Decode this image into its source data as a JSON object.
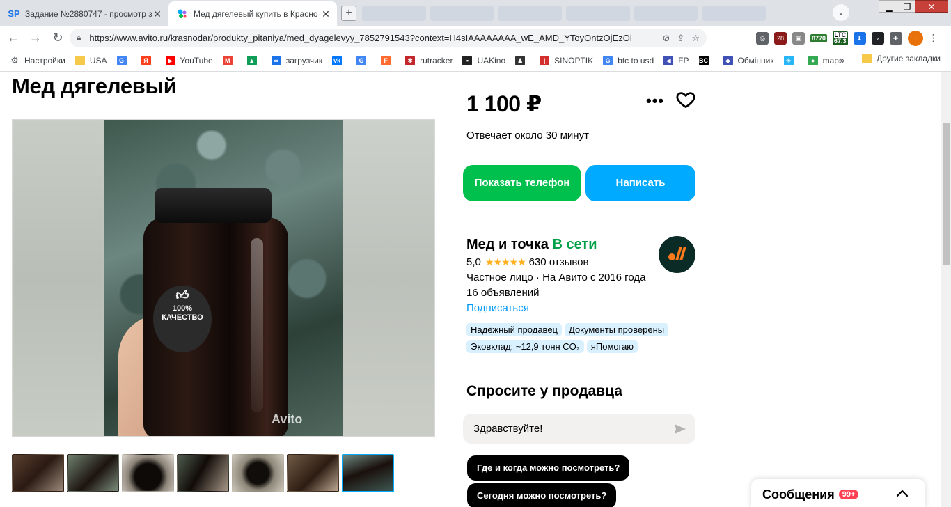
{
  "browser": {
    "tabs": [
      {
        "favicon": "SP",
        "title": "Задание №2880747 - просмотр з"
      },
      {
        "favicon": "avito-icon",
        "title": "Мед дягелевый купить в Красно"
      }
    ],
    "url": "https://www.avito.ru/krasnodar/produkty_pitaniya/med_dyagelevyy_7852791543?context=H4sIAAAAAAAA_wE_AMD_YToyOntzOjEzOi",
    "ext_counter_1": "28",
    "ext_counter_2": "8770",
    "ext_ltc_label": "LTC",
    "ext_ltc_value": "67.3",
    "profile_letter": "I"
  },
  "bookmarks": {
    "items": [
      {
        "label": "Настройки",
        "icon": "gear-icon",
        "color": "#5f6368"
      },
      {
        "label": "USA",
        "icon": "folder-icon",
        "color": "#f6c94a"
      },
      {
        "label": "",
        "icon": "google-icon",
        "color": "#4285f4"
      },
      {
        "label": "",
        "icon": "yandex-icon",
        "color": "#fc3f1d"
      },
      {
        "label": "YouTube",
        "icon": "youtube-icon",
        "color": "#ff0000"
      },
      {
        "label": "",
        "icon": "gmail-icon",
        "color": "#ea4335"
      },
      {
        "label": "",
        "icon": "drive-icon",
        "color": "#0f9d58"
      },
      {
        "label": "загрузчик",
        "icon": "loader-icon",
        "color": "#1a73e8"
      },
      {
        "label": "",
        "icon": "vk-icon",
        "color": "#0077ff"
      },
      {
        "label": "",
        "icon": "translate-icon",
        "color": "#4285f4"
      },
      {
        "label": "",
        "icon": "f-icon",
        "color": "#ff6a2f"
      },
      {
        "label": "rutracker",
        "icon": "rutracker-icon",
        "color": "#c3272b"
      },
      {
        "label": "UAKino",
        "icon": "uakino-icon",
        "color": "#222222"
      },
      {
        "label": "",
        "icon": "bookmark-icon",
        "color": "#333333"
      },
      {
        "label": "SINOPTIK",
        "icon": "sinoptik-icon",
        "color": "#d32f2f"
      },
      {
        "label": "btc to usd",
        "icon": "google-icon",
        "color": "#4285f4"
      },
      {
        "label": "FP",
        "icon": "fp-icon",
        "color": "#3f51b5"
      },
      {
        "label": "",
        "icon": "bc-icon",
        "color": "#000000"
      },
      {
        "label": "Обмінник",
        "icon": "exchange-icon",
        "color": "#3f51b5"
      },
      {
        "label": "",
        "icon": "star-icon",
        "color": "#29b6f6"
      },
      {
        "label": "maps",
        "icon": "maps-icon",
        "color": "#34a853"
      }
    ],
    "more": "»",
    "other": "Другие закладки"
  },
  "listing": {
    "title": "Мед дягелевый",
    "price": "1 100 ₽",
    "response_time": "Отвечает около 30 минут",
    "show_phone_label": "Показать телефон",
    "write_label": "Написать",
    "photo_watermark": "Avito",
    "photo_label_top": "100%",
    "photo_label_bottom": "КАЧЕСТВО",
    "thumbnail_count": 7,
    "selected_thumbnail": 7
  },
  "seller": {
    "name": "Мед и точка",
    "status": "В сети",
    "rating": "5,0",
    "stars": "★★★★★",
    "reviews": "630 отзывов",
    "type": "Частное лицо · На Авито с 2016 года",
    "ads": "16 объявлений",
    "subscribe_label": "Подписаться",
    "badges": [
      "Надёжный продавец",
      "Документы проверены",
      "Эковклад: ~12,9 тонн CO₂",
      "яПомогаю"
    ]
  },
  "ask": {
    "title": "Спросите у продавца",
    "input_value": "Здравствуйте!",
    "chips": [
      "Где и когда можно посмотреть?",
      "Сегодня можно посмотреть?"
    ]
  },
  "messages": {
    "label": "Сообщения",
    "count": "99+"
  },
  "colors": {
    "green": "#00c04d",
    "blue": "#00aaff",
    "online": "#00a046",
    "link": "#0099f7"
  }
}
